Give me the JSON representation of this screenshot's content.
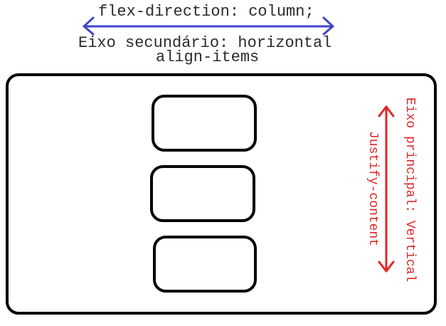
{
  "diagram": {
    "top_label": "flex-direction: column;",
    "cross_axis_label": "Eixo secundário: horizontal",
    "cross_axis_property": "align-items",
    "main_axis_label": "Eixo principal: Vertical",
    "main_axis_property": "Justify-content",
    "flex_items_count": 3
  },
  "colors": {
    "cross_axis_arrow": "#3e46c8",
    "main_axis_arrow": "#e32525",
    "outline": "#000000",
    "text": "#2b2b2b"
  }
}
